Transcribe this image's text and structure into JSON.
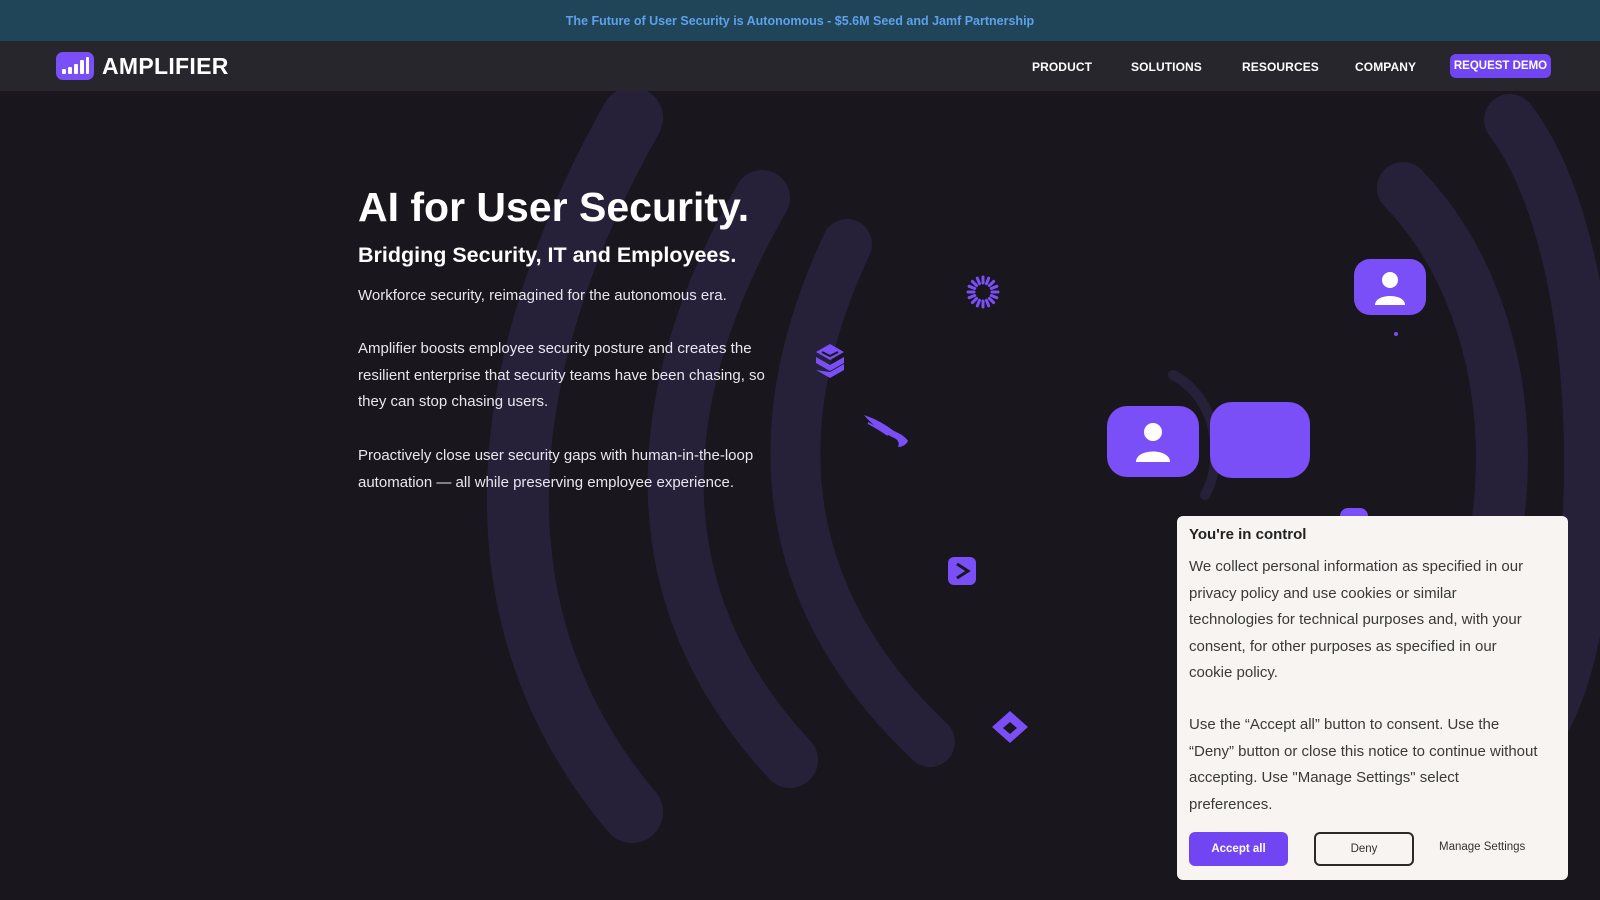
{
  "announcement": {
    "text": "The Future of User Security is Autonomous -  $5.6M Seed and Jamf Partnership"
  },
  "nav": {
    "brand": "AMPLIFIER",
    "items": [
      {
        "label": "PRODUCT"
      },
      {
        "label": "SOLUTIONS"
      },
      {
        "label": "RESOURCES"
      },
      {
        "label": "COMPANY"
      }
    ],
    "cta": "REQUEST DEMO"
  },
  "hero": {
    "title": "AI for User Security.",
    "subtitle": "Bridging Security, IT and Employees.",
    "paragraphs": [
      "Workforce security, reimagined for the autonomous era.",
      "Amplifier boosts employee security posture and creates the resilient enterprise that security teams have been chasing, so they can stop chasing users.",
      "Proactively close user security gaps with human-in-the-loop automation — all while preserving employee experience."
    ]
  },
  "illustration": {
    "icons": [
      "loader-icon",
      "shield-s-icon",
      "falcon-icon",
      "play-icon",
      "diamond-icon",
      "user-icon",
      "user-icon",
      "blank-tile"
    ]
  },
  "cookie": {
    "title": "You're in control",
    "body1": "We collect personal information as specified in our privacy policy and use cookies or similar technologies for technical purposes and, with your consent, for other purposes as specified in our cookie policy.",
    "body2": "Use the “Accept all” button to consent. Use the “Deny” button or close this notice to continue without accepting. Use \"Manage Settings\" select preferences.",
    "accept": "Accept all",
    "deny": "Deny",
    "manage": "Manage Settings"
  },
  "colors": {
    "background": "#19161e",
    "nav_bg": "#28262d",
    "announce_bg": "#204559",
    "announce_text": "#5ea0ea",
    "accent": "#7245f2",
    "arc": "#262139",
    "cookie_bg": "#f7f4f1"
  }
}
